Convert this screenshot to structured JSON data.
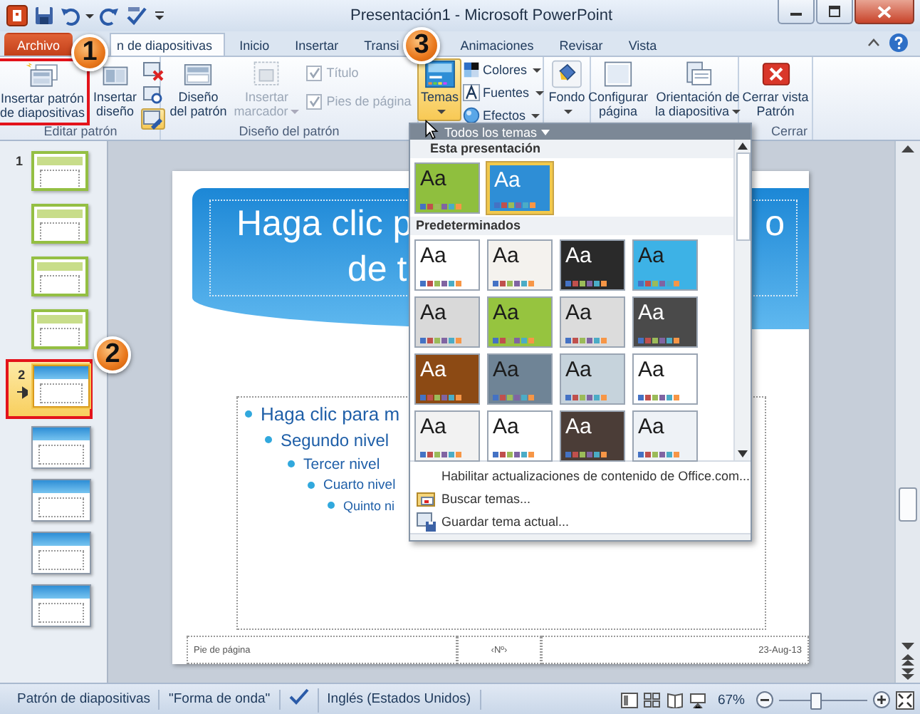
{
  "window": {
    "title": "Presentación1 - Microsoft PowerPoint"
  },
  "tabs": [
    {
      "label": "Archivo",
      "kind": "file",
      "selected": false
    },
    {
      "label": "n de diapositivas",
      "kind": "tab",
      "selected": true
    },
    {
      "label": "Inicio",
      "kind": "tab",
      "selected": false
    },
    {
      "label": "Insertar",
      "kind": "tab",
      "selected": false
    },
    {
      "label": "Transi",
      "kind": "tab",
      "selected": false
    },
    {
      "label": "Animaciones",
      "kind": "tab",
      "selected": false
    },
    {
      "label": "Revisar",
      "kind": "tab",
      "selected": false
    },
    {
      "label": "Vista",
      "kind": "tab",
      "selected": false
    }
  ],
  "ribbon": {
    "groups": [
      {
        "label": "Editar patrón",
        "items": [
          {
            "kind": "big",
            "lines": [
              "Insertar patrón",
              "de diapositivas"
            ],
            "framed": true
          },
          {
            "kind": "big",
            "lines": [
              "Insertar",
              "diseño"
            ]
          },
          {
            "kind": "icons",
            "buttons": [
              {
                "on": false
              },
              {
                "on": false
              },
              {
                "on": true
              }
            ]
          }
        ]
      },
      {
        "label": "Diseño del patrón",
        "items": [
          {
            "kind": "big",
            "lines": [
              "Diseño",
              "del patrón"
            ]
          },
          {
            "kind": "big",
            "lines": [
              "Insertar",
              "marcador"
            ],
            "disabled": true,
            "menu": true
          },
          {
            "kind": "checks",
            "items": [
              {
                "label": "Título",
                "checked": true,
                "disabled": true
              },
              {
                "label": "Pies de página",
                "checked": true,
                "disabled": true
              }
            ]
          }
        ]
      },
      {
        "items": [
          {
            "kind": "big",
            "lines": [
              "Temas"
            ],
            "menu": true,
            "active": true
          },
          {
            "kind": "menus",
            "items": [
              {
                "label": "Colores"
              },
              {
                "label": "Fuentes"
              },
              {
                "label": "Efectos"
              }
            ]
          }
        ]
      },
      {
        "items": [
          {
            "kind": "big",
            "lines": [
              "Fondo"
            ],
            "menu": true
          }
        ]
      },
      {
        "items": [
          {
            "kind": "big",
            "lines": [
              "Configurar",
              "página"
            ]
          },
          {
            "kind": "big",
            "lines": [
              "Orientación de",
              "la diapositiva"
            ],
            "menu": true
          }
        ]
      },
      {
        "label": "Cerrar",
        "items": [
          {
            "kind": "big",
            "lines": [
              "Cerrar vista",
              "Patrón"
            ]
          }
        ]
      }
    ]
  },
  "slides_pane": {
    "thumbnails": [
      {
        "number": "1",
        "kind": "green",
        "selected": false,
        "preserved": false
      },
      {
        "kind": "green",
        "selected": false,
        "preserved": false
      },
      {
        "kind": "green",
        "selected": false,
        "preserved": false
      },
      {
        "kind": "green",
        "selected": false,
        "preserved": false
      },
      {
        "number": "2",
        "kind": "blue",
        "selected": true,
        "preserved": true
      },
      {
        "kind": "blue",
        "selected": false,
        "preserved": false
      },
      {
        "kind": "blue",
        "selected": false,
        "preserved": false
      },
      {
        "kind": "blue",
        "selected": false,
        "preserved": false
      },
      {
        "kind": "blue",
        "selected": false,
        "preserved": false
      }
    ]
  },
  "slide": {
    "title_parts": [
      "Haga clic p",
      "o",
      "de t"
    ],
    "bullets": [
      {
        "text": "Haga clic para m",
        "children": [
          {
            "text": "Segundo nivel",
            "children": [
              {
                "text": "Tercer nivel",
                "children": [
                  {
                    "text": "Cuarto nivel",
                    "children": [
                      {
                        "text": "Quinto ni"
                      }
                    ]
                  }
                ]
              }
            ]
          }
        ]
      }
    ],
    "footer": [
      "Pie de página",
      "‹Nº›",
      "23-Aug-13"
    ]
  },
  "theme_gallery": {
    "header": "Todos los temas",
    "sections": [
      {
        "title": "Esta presentación",
        "themes": [
          {
            "sample": "Aa",
            "color": "#8fbf3e",
            "kind": "light",
            "selected": false
          },
          {
            "sample": "Aa",
            "color": "#2e8ed6",
            "kind": "dark",
            "selected": true
          }
        ]
      },
      {
        "title": "Predeterminados",
        "themes": [
          {
            "sample": "Aa",
            "color": "#ffffff",
            "kind": "light",
            "selected": false
          },
          {
            "sample": "Aa",
            "color": "#f4f2ee",
            "kind": "light",
            "selected": false
          },
          {
            "sample": "Aa",
            "color": "#2a2a2a",
            "kind": "dark",
            "selected": false
          },
          {
            "sample": "Aa",
            "color": "#3db2e6",
            "kind": "light",
            "selected": false
          },
          {
            "sample": "Aa",
            "color": "#d9d9d9",
            "kind": "light",
            "selected": false
          },
          {
            "sample": "Aa",
            "color": "#96c43f",
            "kind": "light",
            "selected": false
          },
          {
            "sample": "Aa",
            "color": "#dcdcdc",
            "kind": "light",
            "selected": false
          },
          {
            "sample": "Aa",
            "color": "#4a4a4a",
            "kind": "dark",
            "selected": false
          },
          {
            "sample": "Aa",
            "color": "#8c4a14",
            "kind": "dark",
            "selected": false
          },
          {
            "sample": "Aa",
            "color": "#6f8496",
            "kind": "light",
            "selected": false
          },
          {
            "sample": "Aa",
            "color": "#c6d3dc",
            "kind": "light",
            "selected": false
          },
          {
            "sample": "Aa",
            "color": "#ffffff",
            "kind": "light",
            "selected": false
          },
          {
            "sample": "Aa",
            "color": "#f2f2f2",
            "kind": "light",
            "selected": false
          },
          {
            "sample": "Aa",
            "color": "#ffffff",
            "kind": "light",
            "selected": false
          },
          {
            "sample": "Aa",
            "color": "#4b3d37",
            "kind": "dark",
            "selected": false
          },
          {
            "sample": "Aa",
            "color": "#eef2f6",
            "kind": "light",
            "selected": false
          }
        ]
      }
    ],
    "menu_items": [
      {
        "label": "Habilitar actualizaciones de contenido de Office.com..."
      },
      {
        "label": "Buscar temas..."
      },
      {
        "label": "Guardar tema actual..."
      }
    ]
  },
  "status_bar": {
    "view": "Patrón de diapositivas",
    "theme": "\"Forma de onda\"",
    "language": "Inglés (Estados Unidos)",
    "zoom": "67%",
    "zoom_slider": {
      "level": 0.42
    }
  },
  "callouts": [
    {
      "number": "1"
    },
    {
      "number": "2"
    },
    {
      "number": "3"
    }
  ]
}
